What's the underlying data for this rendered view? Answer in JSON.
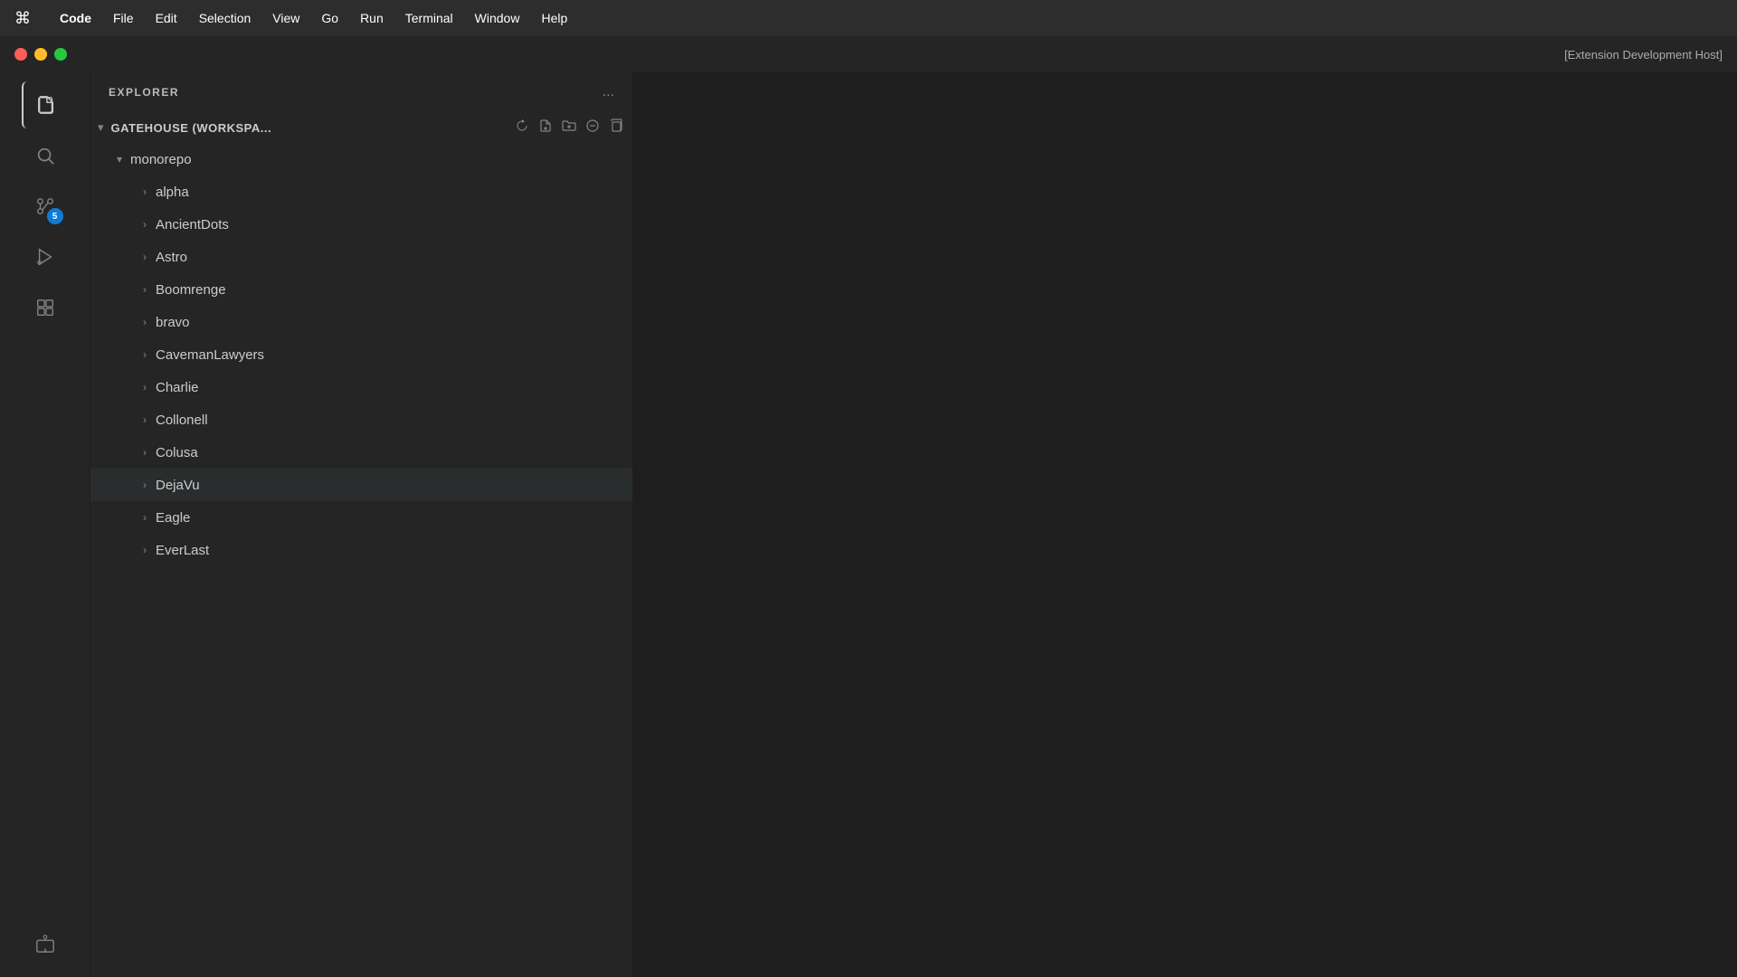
{
  "menubar": {
    "apple": "⌘",
    "items": [
      "Code",
      "File",
      "Edit",
      "Selection",
      "View",
      "Go",
      "Run",
      "Terminal",
      "Window",
      "Help"
    ]
  },
  "titlebar": {
    "extension_text": "[Extension Development Host]",
    "window_controls": {
      "close": "close",
      "minimize": "minimize",
      "maximize": "maximize"
    }
  },
  "activitybar": {
    "icons": [
      {
        "name": "explorer-icon",
        "symbol": "📄",
        "active": true,
        "badge": null
      },
      {
        "name": "search-icon",
        "symbol": "🔍",
        "active": false,
        "badge": null
      },
      {
        "name": "source-control-icon",
        "symbol": "⎇",
        "active": false,
        "badge": "5"
      },
      {
        "name": "run-debug-icon",
        "symbol": "▷",
        "active": false,
        "badge": null
      },
      {
        "name": "extensions-icon",
        "symbol": "⊞",
        "active": false,
        "badge": null
      },
      {
        "name": "remote-explorer-icon",
        "symbol": "🖥",
        "active": false,
        "badge": null
      }
    ]
  },
  "sidebar": {
    "title": "EXPLORER",
    "more_actions_label": "...",
    "workspace": {
      "name": "GATEHOUSE (WORKSPA...",
      "chevron": "▾"
    },
    "workspace_actions": [
      "↻",
      "📄",
      "📁",
      "↺",
      "⧉"
    ],
    "monorepo": {
      "name": "monorepo",
      "chevron": "▾"
    },
    "folders": [
      {
        "name": "alpha",
        "highlighted": false
      },
      {
        "name": "AncientDots",
        "highlighted": false
      },
      {
        "name": "Astro",
        "highlighted": false
      },
      {
        "name": "Boomrenge",
        "highlighted": false
      },
      {
        "name": "bravo",
        "highlighted": false
      },
      {
        "name": "CavemanLawyers",
        "highlighted": false
      },
      {
        "name": "Charlie",
        "highlighted": false
      },
      {
        "name": "Collonell",
        "highlighted": false
      },
      {
        "name": "Colusa",
        "highlighted": false
      },
      {
        "name": "DejaVu",
        "highlighted": true
      },
      {
        "name": "Eagle",
        "highlighted": false
      },
      {
        "name": "EverLast",
        "highlighted": false
      }
    ]
  }
}
